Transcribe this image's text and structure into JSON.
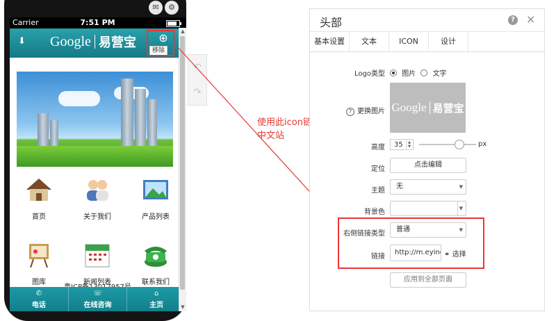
{
  "phone": {
    "status_bar": {
      "carrier": "Carrier",
      "time": "7:51 PM"
    },
    "header": {
      "logo_google": "Google",
      "logo_chinese": "易营宝",
      "remove_label": "移除"
    },
    "grid": [
      {
        "label": "首页",
        "icon": "house-icon"
      },
      {
        "label": "关于我们",
        "icon": "people-icon"
      },
      {
        "label": "产品列表",
        "icon": "picture-icon"
      },
      {
        "label": "图库",
        "icon": "easel-icon"
      },
      {
        "label": "新闻列表",
        "icon": "calendar-icon"
      },
      {
        "label": "联系我们",
        "icon": "phone-icon"
      }
    ],
    "icp": "粤ICP备13017957号",
    "bottom_nav": [
      {
        "label": "电话",
        "icon": "phone-icon"
      },
      {
        "label": "在线咨询",
        "icon": "chat-icon"
      },
      {
        "label": "主页",
        "icon": "home-icon"
      }
    ]
  },
  "annotation": "使用此icon链接到中文站",
  "panel": {
    "title": "头部",
    "tabs": [
      "基本设置",
      "文本",
      "ICON",
      "设计"
    ],
    "logo_type_label": "Logo类型",
    "logo_type_options": [
      "图片",
      "文字"
    ],
    "logo_type_selected": "图片",
    "change_image_label": "更换图片",
    "preview_google": "Google",
    "preview_chinese": "易营宝",
    "height_label": "高度",
    "height_value": "35",
    "height_unit": "px",
    "position_label": "定位",
    "position_button": "点击编辑",
    "theme_label": "主题",
    "theme_value": "无",
    "bg_color_label": "背景色",
    "right_link_type_label": "右侧链接类型",
    "right_link_type_value": "普通",
    "link_label": "链接",
    "link_value": "http://m.eyingb",
    "link_choose": "选择",
    "apply_all_button": "应用到全部页面"
  }
}
